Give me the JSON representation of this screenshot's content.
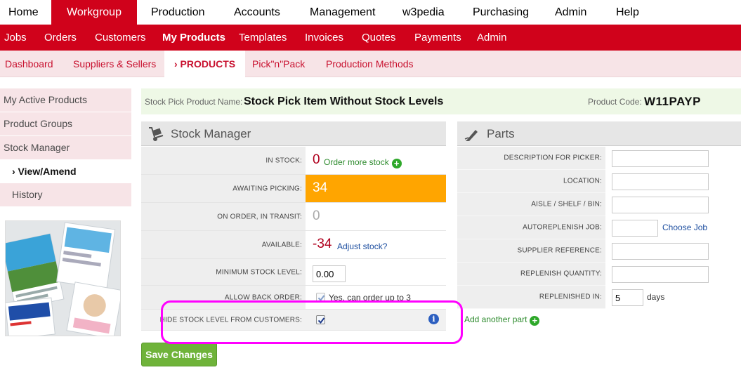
{
  "top_nav": {
    "items": [
      {
        "label": "Home",
        "color": "#d0021b"
      },
      {
        "label": "Workgroup",
        "color": "#ffffff"
      },
      {
        "label": "Production",
        "color": "#1a9e8f"
      },
      {
        "label": "Accounts",
        "color": "#f07800"
      },
      {
        "label": "Management",
        "color": "#c8102e"
      },
      {
        "label": "w3pedia",
        "color": "#1e3a8a"
      },
      {
        "label": "Purchasing",
        "color": "#a4263c"
      },
      {
        "label": "Admin",
        "color": "#2e8b2e"
      },
      {
        "label": "Help",
        "color": "#f0a500"
      }
    ],
    "active": "Workgroup"
  },
  "sub_nav": {
    "items": [
      "Jobs",
      "Orders",
      "Customers",
      "My Products",
      "Templates",
      "Invoices",
      "Quotes",
      "Payments",
      "Admin"
    ],
    "active": "My Products"
  },
  "tab_bar": {
    "items": [
      "Dashboard",
      "Suppliers & Sellers",
      "› PRODUCTS",
      "Pick\"n\"Pack",
      "Production Methods"
    ],
    "active": "› PRODUCTS"
  },
  "sidebar": {
    "items": [
      "My Active Products",
      "Product Groups",
      "Stock Manager",
      "› View/Amend",
      "History"
    ]
  },
  "product": {
    "name_label": "Stock Pick Product Name:",
    "name": "Stock Pick Item Without Stock Levels",
    "code_label": "Product Code:",
    "code": "W11PAYP"
  },
  "stock_manager": {
    "title": "Stock Manager",
    "icon": "hand-truck-icon",
    "in_stock_label": "IN STOCK:",
    "in_stock_value": "0",
    "order_more_link": "Order more stock",
    "awaiting_label": "AWAITING PICKING:",
    "awaiting_value": "34",
    "on_order_label": "ON ORDER, IN TRANSIT:",
    "on_order_value": "0",
    "available_label": "AVAILABLE:",
    "available_value": "-34",
    "adjust_link": "Adjust stock?",
    "min_label": "MINIMUM STOCK LEVEL:",
    "min_value": "0.00",
    "backorder_label": "ALLOW BACK ORDER:",
    "backorder_text": "Yes, can order up to 3",
    "hide_label": "HIDE STOCK LEVEL FROM CUSTOMERS:",
    "hide_checked": true,
    "backorder_checked": true
  },
  "parts": {
    "title": "Parts",
    "icon": "pen-icon",
    "desc_label": "DESCRIPTION FOR PICKER:",
    "location_label": "LOCATION:",
    "aisle_label": "AISLE / SHELF / BIN:",
    "autoreplenish_label": "AUTOREPLENISH JOB:",
    "choose_job_link": "Choose Job",
    "supplier_ref_label": "SUPPLIER REFERENCE:",
    "replenish_qty_label": "REPLENISH QUANTITY:",
    "replenished_in_label": "REPLENISHED IN:",
    "replenished_in_value": "5",
    "days_label": "days",
    "add_part_link": "Add another part"
  },
  "actions": {
    "save_label": "Save Changes"
  },
  "colors": {
    "brand_red": "#d0021b",
    "awaiting_orange": "#ffa500",
    "link_green": "#2e8b2e",
    "link_blue": "#1e4fa0",
    "highlight": "#ff00ff"
  }
}
